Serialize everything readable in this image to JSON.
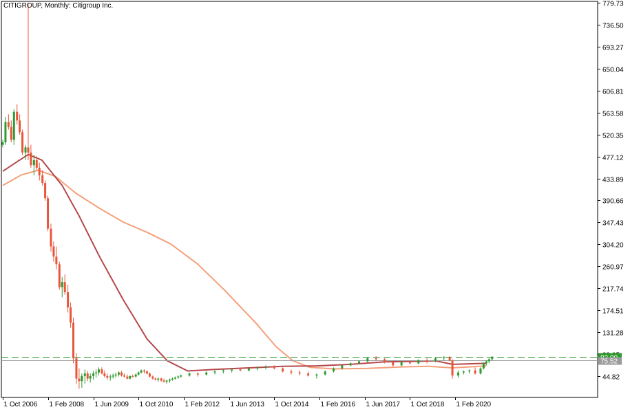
{
  "chart_data": {
    "type": "candlestick",
    "title": "CITIGROUP, Monthly:  Citigroup Inc.",
    "symbol": "CITIGROUP",
    "timeframe": "Monthly",
    "instrument": "Citigroup Inc.",
    "y_ticks": [
      "779.73",
      "736.50",
      "693.27",
      "650.04",
      "606.81",
      "563.58",
      "520.35",
      "477.12",
      "433.89",
      "390.66",
      "347.43",
      "304.20",
      "260.97",
      "217.74",
      "174.51",
      "131.28",
      "88.05",
      "44.82"
    ],
    "ylim": [
      20,
      779.73
    ],
    "x_ticks": [
      {
        "label": "1 Oct 2006",
        "t": 2006.75
      },
      {
        "label": "1 Feb 2008",
        "t": 2008.08
      },
      {
        "label": "1 Jun 2009",
        "t": 2009.42
      },
      {
        "label": "1 Oct 2010",
        "t": 2010.75
      },
      {
        "label": "1 Feb 2012",
        "t": 2012.08
      },
      {
        "label": "1 Jun 2013",
        "t": 2013.42
      },
      {
        "label": "1 Oct 2014",
        "t": 2014.75
      },
      {
        "label": "1 Feb 2016",
        "t": 2016.08
      },
      {
        "label": "1 Jun 2017",
        "t": 2017.42
      },
      {
        "label": "1 Oct 2018",
        "t": 2018.75
      },
      {
        "label": "1 Feb 2020",
        "t": 2020.08
      }
    ],
    "current_price": {
      "value": 83.0,
      "label": "83.00",
      "color": "#2e9b2e"
    },
    "secondary_level": {
      "value": 75.5,
      "label": "75.52"
    },
    "colors": {
      "bull": "#2e9b2e",
      "bear": "#e8553a",
      "ma_fast": "#b5474b",
      "ma_slow": "#f4a07a",
      "hline": "#2e9b2e"
    },
    "ma_fast": {
      "points": [
        [
          2006.75,
          448
        ],
        [
          2007.2,
          468
        ],
        [
          2007.5,
          481
        ],
        [
          2007.9,
          470
        ],
        [
          2008.5,
          420
        ],
        [
          2009.0,
          360
        ],
        [
          2009.6,
          280
        ],
        [
          2010.3,
          195
        ],
        [
          2011.0,
          118
        ],
        [
          2011.6,
          75
        ],
        [
          2012.2,
          55
        ],
        [
          2013.0,
          58
        ],
        [
          2014.0,
          61
        ],
        [
          2015.0,
          64
        ],
        [
          2016.0,
          65
        ],
        [
          2017.0,
          68
        ],
        [
          2018.0,
          73
        ],
        [
          2019.0,
          74
        ],
        [
          2019.5,
          75
        ],
        [
          2020.0,
          68
        ],
        [
          2020.5,
          69
        ],
        [
          2021.0,
          70
        ]
      ]
    },
    "ma_slow": {
      "points": [
        [
          2006.75,
          420
        ],
        [
          2007.3,
          441
        ],
        [
          2007.8,
          450
        ],
        [
          2008.3,
          438
        ],
        [
          2008.9,
          405
        ],
        [
          2009.6,
          375
        ],
        [
          2010.3,
          348
        ],
        [
          2011.0,
          328
        ],
        [
          2011.7,
          305
        ],
        [
          2012.5,
          265
        ],
        [
          2013.3,
          213
        ],
        [
          2014.2,
          150
        ],
        [
          2014.8,
          103
        ],
        [
          2015.3,
          75
        ],
        [
          2015.8,
          62
        ],
        [
          2016.5,
          59
        ],
        [
          2017.5,
          60
        ],
        [
          2018.5,
          63
        ],
        [
          2019.3,
          64
        ],
        [
          2020.0,
          61
        ],
        [
          2020.5,
          63
        ],
        [
          2021.0,
          65
        ]
      ]
    },
    "candles_ohlc": [
      [
        2006.75,
        500,
        510,
        495,
        505
      ],
      [
        2006.83,
        505,
        555,
        500,
        545
      ],
      [
        2006.92,
        545,
        560,
        530,
        535
      ],
      [
        2007.0,
        535,
        548,
        505,
        510
      ],
      [
        2007.08,
        510,
        570,
        500,
        565
      ],
      [
        2007.17,
        565,
        580,
        540,
        548
      ],
      [
        2007.25,
        548,
        560,
        520,
        525
      ],
      [
        2007.33,
        525,
        530,
        480,
        485
      ],
      [
        2007.42,
        485,
        500,
        470,
        495
      ],
      [
        2007.5,
        495,
        779.73,
        470,
        485
      ],
      [
        2007.58,
        485,
        500,
        455,
        460
      ],
      [
        2007.67,
        460,
        480,
        440,
        470
      ],
      [
        2007.75,
        470,
        478,
        450,
        455
      ],
      [
        2007.83,
        455,
        465,
        430,
        440
      ],
      [
        2007.92,
        440,
        450,
        420,
        425
      ],
      [
        2008.0,
        425,
        430,
        390,
        395
      ],
      [
        2008.08,
        395,
        400,
        330,
        335
      ],
      [
        2008.17,
        335,
        345,
        290,
        300
      ],
      [
        2008.25,
        300,
        310,
        270,
        280
      ],
      [
        2008.33,
        280,
        300,
        255,
        265
      ],
      [
        2008.42,
        265,
        270,
        215,
        220
      ],
      [
        2008.5,
        220,
        240,
        200,
        230
      ],
      [
        2008.58,
        230,
        245,
        205,
        210
      ],
      [
        2008.67,
        210,
        225,
        170,
        180
      ],
      [
        2008.75,
        180,
        190,
        140,
        150
      ],
      [
        2008.83,
        150,
        160,
        70,
        80
      ],
      [
        2008.92,
        80,
        90,
        30,
        40
      ],
      [
        2009.0,
        40,
        60,
        20,
        35
      ],
      [
        2009.08,
        35,
        50,
        22,
        45
      ],
      [
        2009.17,
        45,
        58,
        30,
        50
      ],
      [
        2009.25,
        50,
        55,
        35,
        40
      ],
      [
        2009.33,
        40,
        50,
        32,
        45
      ],
      [
        2009.42,
        45,
        55,
        38,
        50
      ],
      [
        2009.5,
        50,
        58,
        42,
        52
      ],
      [
        2009.58,
        52,
        62,
        46,
        58
      ],
      [
        2009.67,
        58,
        62,
        48,
        50
      ],
      [
        2009.75,
        50,
        56,
        42,
        45
      ],
      [
        2009.83,
        45,
        50,
        38,
        42
      ],
      [
        2009.92,
        42,
        48,
        36,
        44
      ],
      [
        2010.0,
        44,
        50,
        40,
        46
      ],
      [
        2010.08,
        46,
        52,
        42,
        48
      ],
      [
        2010.17,
        48,
        54,
        44,
        52
      ],
      [
        2010.25,
        52,
        55,
        44,
        46
      ],
      [
        2010.33,
        46,
        50,
        42,
        44
      ],
      [
        2010.42,
        44,
        48,
        38,
        40
      ],
      [
        2010.5,
        40,
        46,
        38,
        45
      ],
      [
        2010.58,
        45,
        48,
        42,
        44
      ],
      [
        2010.67,
        44,
        50,
        42,
        48
      ],
      [
        2010.75,
        48,
        54,
        46,
        52
      ],
      [
        2010.83,
        52,
        58,
        50,
        56
      ],
      [
        2010.92,
        56,
        58,
        50,
        54
      ],
      [
        2011.0,
        54,
        56,
        48,
        50
      ],
      [
        2011.08,
        50,
        52,
        42,
        44
      ],
      [
        2011.17,
        44,
        46,
        38,
        40
      ],
      [
        2011.25,
        40,
        42,
        36,
        38
      ],
      [
        2011.33,
        38,
        42,
        34,
        40
      ],
      [
        2011.42,
        40,
        42,
        34,
        36
      ],
      [
        2011.5,
        36,
        40,
        32,
        34
      ],
      [
        2011.58,
        34,
        38,
        30,
        36
      ],
      [
        2011.67,
        36,
        40,
        32,
        38
      ],
      [
        2011.75,
        38,
        42,
        36,
        40
      ],
      [
        2011.83,
        40,
        44,
        38,
        42
      ],
      [
        2011.92,
        42,
        46,
        40,
        44
      ],
      [
        2012.0,
        44,
        48,
        42,
        46
      ],
      [
        2012.25,
        46,
        52,
        44,
        50
      ],
      [
        2012.5,
        50,
        52,
        44,
        48
      ],
      [
        2012.75,
        48,
        54,
        46,
        52
      ],
      [
        2013.0,
        52,
        56,
        48,
        54
      ],
      [
        2013.25,
        54,
        58,
        50,
        56
      ],
      [
        2013.5,
        56,
        60,
        52,
        58
      ],
      [
        2013.75,
        58,
        60,
        54,
        56
      ],
      [
        2014.0,
        56,
        62,
        54,
        60
      ],
      [
        2014.25,
        60,
        64,
        56,
        62
      ],
      [
        2014.5,
        62,
        66,
        58,
        64
      ],
      [
        2014.75,
        64,
        66,
        58,
        60
      ],
      [
        2015.0,
        60,
        62,
        52,
        54
      ],
      [
        2015.25,
        54,
        58,
        48,
        52
      ],
      [
        2015.5,
        52,
        56,
        46,
        50
      ],
      [
        2015.75,
        50,
        54,
        44,
        46
      ],
      [
        2016.0,
        46,
        50,
        40,
        48
      ],
      [
        2016.25,
        48,
        56,
        46,
        54
      ],
      [
        2016.5,
        54,
        62,
        52,
        60
      ],
      [
        2016.75,
        60,
        68,
        58,
        66
      ],
      [
        2017.0,
        66,
        72,
        64,
        70
      ],
      [
        2017.25,
        70,
        76,
        68,
        74
      ],
      [
        2017.5,
        74,
        82,
        72,
        80
      ],
      [
        2017.75,
        80,
        84,
        76,
        78
      ],
      [
        2018.0,
        78,
        80,
        70,
        72
      ],
      [
        2018.25,
        72,
        74,
        64,
        66
      ],
      [
        2018.5,
        66,
        74,
        64,
        72
      ],
      [
        2018.75,
        72,
        76,
        68,
        70
      ],
      [
        2019.0,
        70,
        78,
        68,
        76
      ],
      [
        2019.25,
        76,
        80,
        70,
        74
      ],
      [
        2019.5,
        74,
        82,
        72,
        80
      ],
      [
        2019.75,
        80,
        84,
        76,
        82
      ],
      [
        2019.92,
        82,
        84,
        74,
        76
      ],
      [
        2020.0,
        76,
        78,
        40,
        46
      ],
      [
        2020.17,
        46,
        56,
        42,
        52
      ],
      [
        2020.33,
        52,
        56,
        48,
        54
      ],
      [
        2020.5,
        54,
        58,
        50,
        56
      ],
      [
        2020.67,
        56,
        62,
        48,
        50
      ],
      [
        2020.83,
        50,
        62,
        48,
        60
      ],
      [
        2020.92,
        60,
        72,
        58,
        70
      ],
      [
        2021.0,
        70,
        76,
        66,
        74
      ],
      [
        2021.08,
        74,
        80,
        70,
        78
      ],
      [
        2021.17,
        78,
        84,
        76,
        83
      ]
    ]
  }
}
